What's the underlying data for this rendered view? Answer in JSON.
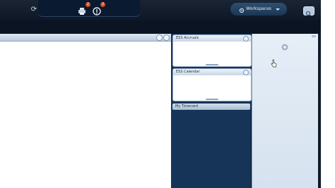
{
  "topbar": {
    "sync_icon": "sync-icon",
    "notifications": [
      {
        "icon": "printer-icon",
        "badge": "2"
      },
      {
        "icon": "info-icon",
        "badge": "3"
      }
    ],
    "workspaces_label": "Workspaces",
    "search_icon": "search-icon"
  },
  "widgets": {
    "accruals_title": "ESS Accruals",
    "calendar_title": "ESS Calendar",
    "timecard_title": "My Timecard"
  },
  "colors": {
    "app_background": "#0f1a2b",
    "badge": "#e04a1b",
    "widget_column": "#153458",
    "right_panel": "#dbe6f2"
  }
}
